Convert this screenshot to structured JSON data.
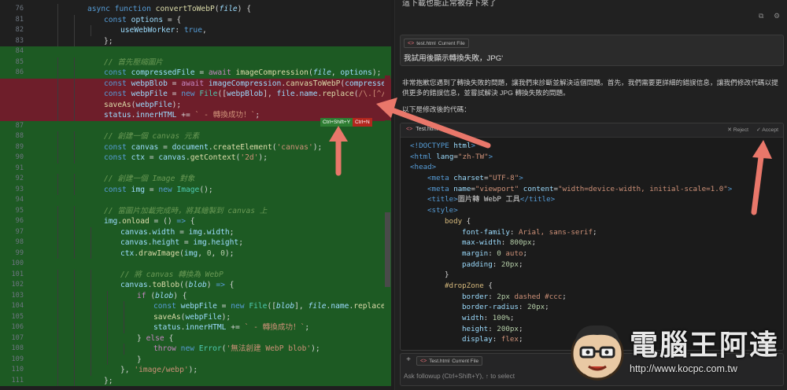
{
  "editor": {
    "lines": [
      {
        "n": "76",
        "kind": "plain",
        "indent": 2,
        "html": "<span class='k'>async</span> <span class='k'>function</span> <span class='f'>convertToWebP</span>(<span class='p'>file</span>) {"
      },
      {
        "n": "81",
        "kind": "plain",
        "indent": 3,
        "html": "<span class='k'>const</span> <span class='v'>options</span> = {"
      },
      {
        "n": "82",
        "kind": "plain",
        "indent": 4,
        "html": "<span class='v'>useWebWorker</span>: <span class='k'>true</span>,"
      },
      {
        "n": "83",
        "kind": "plain",
        "indent": 3,
        "html": "};"
      },
      {
        "n": "84",
        "kind": "added-empty",
        "indent": 0,
        "html": ""
      },
      {
        "n": "85",
        "kind": "add",
        "indent": 3,
        "html": "<span class='cm'>// 首先壓縮圖片</span>"
      },
      {
        "n": "86",
        "kind": "add",
        "indent": 3,
        "html": "<span class='k'>const</span> <span class='v'>compressedFile</span> = <span class='c'>await</span> <span class='f'>imageCompression</span>(<span class='p'>file</span>, <span class='v'>options</span>);"
      },
      {
        "n": "",
        "kind": "del",
        "indent": 3,
        "html": "<span class='k'>const</span> <span class='v'>webpBlob</span> = <span class='c'>await</span> <span class='v'>imageCompression</span>.<span class='f'>canvasToWebP</span>(<span class='v'>compressedFile</span>"
      },
      {
        "n": "",
        "kind": "del",
        "indent": 3,
        "html": "<span class='k'>const</span> <span class='v'>webpFile</span> = <span class='k'>new</span> <span class='t'>File</span>([<span class='v'>webpBlob</span>], <span class='v'>file</span>.<span class='v'>name</span>.<span class='f'>replace</span>(<span class='s'>/\\.[^/.]+</span>"
      },
      {
        "n": "",
        "kind": "del",
        "indent": 3,
        "html": "<span class='f'>saveAs</span>(<span class='v'>webpFile</span>);"
      },
      {
        "n": "",
        "kind": "del",
        "indent": 3,
        "html": "<span class='v'>status</span>.<span class='v'>innerHTML</span> += <span class='s'>` - 轉換成功！`</span>;"
      },
      {
        "n": "87",
        "kind": "add",
        "indent": 0,
        "html": ""
      },
      {
        "n": "88",
        "kind": "add",
        "indent": 3,
        "html": "<span class='cm'>// 創建一個 canvas 元素</span>"
      },
      {
        "n": "89",
        "kind": "add",
        "indent": 3,
        "html": "<span class='k'>const</span> <span class='v'>canvas</span> = <span class='v'>document</span>.<span class='f'>createElement</span>(<span class='s'>'canvas'</span>);"
      },
      {
        "n": "90",
        "kind": "add",
        "indent": 3,
        "html": "<span class='k'>const</span> <span class='v'>ctx</span> = <span class='v'>canvas</span>.<span class='f'>getContext</span>(<span class='s'>'2d'</span>);"
      },
      {
        "n": "91",
        "kind": "add",
        "indent": 0,
        "html": ""
      },
      {
        "n": "92",
        "kind": "add",
        "indent": 3,
        "html": "<span class='cm'>// 創建一個 Image 對象</span>"
      },
      {
        "n": "93",
        "kind": "add",
        "indent": 3,
        "html": "<span class='k'>const</span> <span class='v'>img</span> = <span class='k'>new</span> <span class='t'>Image</span>();"
      },
      {
        "n": "94",
        "kind": "add",
        "indent": 0,
        "html": ""
      },
      {
        "n": "95",
        "kind": "add",
        "indent": 3,
        "html": "<span class='cm'>// 當圖片加載完成時，將其繪製到 canvas 上</span>"
      },
      {
        "n": "96",
        "kind": "add",
        "indent": 3,
        "html": "<span class='v'>img</span>.<span class='f'>onload</span> = () <span class='k'>=&gt;</span> {"
      },
      {
        "n": "97",
        "kind": "add",
        "indent": 4,
        "html": "<span class='v'>canvas</span>.<span class='v'>width</span> = <span class='v'>img</span>.<span class='v'>width</span>;"
      },
      {
        "n": "98",
        "kind": "add",
        "indent": 4,
        "html": "<span class='v'>canvas</span>.<span class='v'>height</span> = <span class='v'>img</span>.<span class='v'>height</span>;"
      },
      {
        "n": "99",
        "kind": "add",
        "indent": 4,
        "html": "<span class='v'>ctx</span>.<span class='f'>drawImage</span>(<span class='v'>img</span>, <span class='n'>0</span>, <span class='n'>0</span>);"
      },
      {
        "n": "100",
        "kind": "add",
        "indent": 0,
        "html": ""
      },
      {
        "n": "101",
        "kind": "add",
        "indent": 4,
        "html": "<span class='cm'>// 將 canvas 轉換為 WebP</span>"
      },
      {
        "n": "102",
        "kind": "add",
        "indent": 4,
        "html": "<span class='v'>canvas</span>.<span class='f'>toBlob</span>((<span class='p'>blob</span>) <span class='k'>=&gt;</span> {"
      },
      {
        "n": "103",
        "kind": "add",
        "indent": 5,
        "html": "<span class='c'>if</span> (<span class='p'>blob</span>) {"
      },
      {
        "n": "104",
        "kind": "add",
        "indent": 6,
        "html": "<span class='k'>const</span> <span class='v'>webpFile</span> = <span class='k'>new</span> <span class='t'>File</span>([<span class='p'>blob</span>], <span class='p'>file</span>.<span class='v'>name</span>.<span class='f'>replace</span>(/"
      },
      {
        "n": "105",
        "kind": "add",
        "indent": 6,
        "html": "<span class='f'>saveAs</span>(<span class='v'>webpFile</span>);"
      },
      {
        "n": "106",
        "kind": "add",
        "indent": 6,
        "html": "<span class='v'>status</span>.<span class='v'>innerHTML</span> += <span class='s'>` - 轉換成功！`</span>;"
      },
      {
        "n": "107",
        "kind": "add",
        "indent": 5,
        "html": "} <span class='c'>else</span> {"
      },
      {
        "n": "108",
        "kind": "add",
        "indent": 6,
        "html": "<span class='c'>throw</span> <span class='k'>new</span> <span class='t'>Error</span>(<span class='s'>'無法創建 WebP blob'</span>);"
      },
      {
        "n": "109",
        "kind": "add",
        "indent": 5,
        "html": "}"
      },
      {
        "n": "110",
        "kind": "add",
        "indent": 4,
        "html": "}, <span class='s'>'image/webp'</span>);"
      },
      {
        "n": "111",
        "kind": "add",
        "indent": 3,
        "html": "};"
      }
    ],
    "chips": {
      "accept": "Ctrl+Shift+Y",
      "reject": "Ctrl+N"
    }
  },
  "chat": {
    "top_text": "這下載也能正常被存下來了",
    "user_message": {
      "file_label": "test.html",
      "file_sub": "Current File",
      "text": "我試用後顯示轉換失敗，JPG'"
    },
    "reply": "非常抱歉您遇到了轉換失敗的問題，讓我們來診斷並解決這個問題。首先，我們需要更詳細的錯誤信息，讓我們修改代碼以提供更多的錯誤信息，並嘗試解決 JPG 轉換失敗的問題。",
    "reply_intro": "以下是修改後的代碼：",
    "card": {
      "file": "Test.html",
      "reject": "Reject",
      "accept": "Accept",
      "lines": [
        {
          "i": 0,
          "html": "<span class='tag'>&lt;!DOCTYPE</span> <span class='att'>html</span><span class='tag'>&gt;</span>"
        },
        {
          "i": 0,
          "html": "<span class='tag'>&lt;html</span> <span class='att'>lang</span>=<span class='val'>\"zh-TW\"</span><span class='tag'>&gt;</span>"
        },
        {
          "i": 0,
          "html": "<span class='tag'>&lt;head&gt;</span>"
        },
        {
          "i": 1,
          "html": "<span class='tag'>&lt;meta</span> <span class='att'>charset</span>=<span class='val'>\"UTF-8\"</span><span class='tag'>&gt;</span>"
        },
        {
          "i": 1,
          "html": "<span class='tag'>&lt;meta</span> <span class='att'>name</span>=<span class='val'>\"viewport\"</span> <span class='att'>content</span>=<span class='val'>\"width=device-width, initial-scale=1.0\"</span><span class='tag'>&gt;</span>"
        },
        {
          "i": 1,
          "html": "<span class='tag'>&lt;title&gt;</span>圖片轉 WebP 工具<span class='tag'>&lt;/title&gt;</span>"
        },
        {
          "i": 1,
          "html": "<span class='tag'>&lt;style&gt;</span>"
        },
        {
          "i": 2,
          "html": "<span class='sel'>body</span> {"
        },
        {
          "i": 3,
          "html": "<span class='prop'>font-family</span>: <span class='pv'>Arial, sans-serif</span>;"
        },
        {
          "i": 3,
          "html": "<span class='prop'>max-width</span>: <span class='num'>800px</span>;"
        },
        {
          "i": 3,
          "html": "<span class='prop'>margin</span>: <span class='num'>0</span> <span class='pv'>auto</span>;"
        },
        {
          "i": 3,
          "html": "<span class='prop'>padding</span>: <span class='num'>20px</span>;"
        },
        {
          "i": 2,
          "html": "}"
        },
        {
          "i": 2,
          "html": "<span class='sel'>#dropZone</span> {"
        },
        {
          "i": 3,
          "html": "<span class='prop'>border</span>: <span class='num'>2px</span> <span class='pv'>dashed #ccc</span>;"
        },
        {
          "i": 3,
          "html": "<span class='prop'>border-radius</span>: <span class='num'>20px</span>;"
        },
        {
          "i": 3,
          "html": "<span class='prop'>width</span>: <span class='num'>100%</span>;"
        },
        {
          "i": 3,
          "html": "<span class='prop'>height</span>: <span class='num'>200px</span>;"
        },
        {
          "i": 3,
          "html": "<span class='prop'>display</span>: <span class='pv'>flex</span>;"
        }
      ]
    },
    "followup": {
      "file_label": "Test.html",
      "file_sub": "Current File",
      "placeholder": "Ask followup (Ctrl+Shift+Y), ↑ to select"
    }
  },
  "watermark": {
    "title": "電腦王阿達",
    "url": "http://www.kocpc.com.tw"
  },
  "colors": {
    "added": "#1d5a23",
    "deleted": "#6e1e2a",
    "arrow": "#e9776a"
  },
  "icons": [
    "copy-icon",
    "settings-icon",
    "file-icon",
    "close-icon",
    "check-icon",
    "plus-icon",
    "arrow-annotation"
  ]
}
